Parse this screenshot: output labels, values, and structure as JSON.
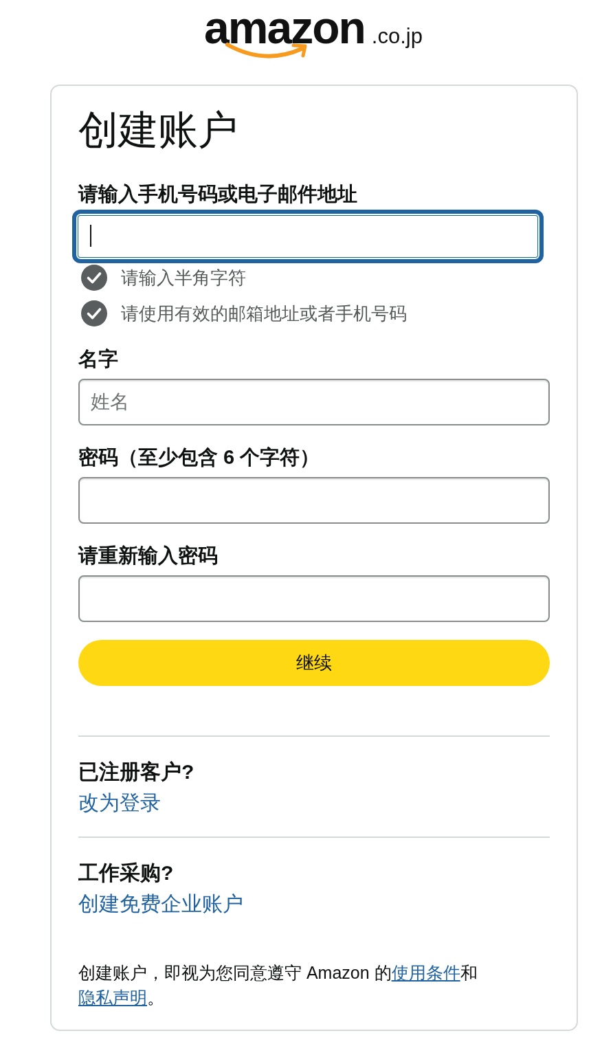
{
  "logo": {
    "wordmark": "amazon",
    "suffix": ".co.jp"
  },
  "card": {
    "title": "创建账户",
    "fields": [
      {
        "label": "请输入手机号码或电子邮件地址",
        "focused": true,
        "hints": [
          "请输入半角字符",
          "请使用有效的邮箱地址或者手机号码"
        ]
      },
      {
        "label": "名字",
        "placeholder": "姓名",
        "focused": false
      },
      {
        "label": "密码（至少包含 6 个字符）",
        "focused": false
      },
      {
        "label": "请重新输入密码",
        "focused": false
      }
    ],
    "continue_button": "继续",
    "sections": [
      {
        "heading": "已注册客户?",
        "link": "改为登录"
      },
      {
        "heading": "工作采购?",
        "link": "创建免费企业账户"
      }
    ],
    "legal": [
      {
        "kind": "text",
        "text": "创建账户，即视为您同意遵守 Amazon 的"
      },
      {
        "kind": "link",
        "text": "使用条件"
      },
      {
        "kind": "text",
        "text": "和"
      },
      {
        "kind": "link",
        "text": "隐私声明"
      },
      {
        "kind": "text",
        "text": "。"
      }
    ]
  }
}
